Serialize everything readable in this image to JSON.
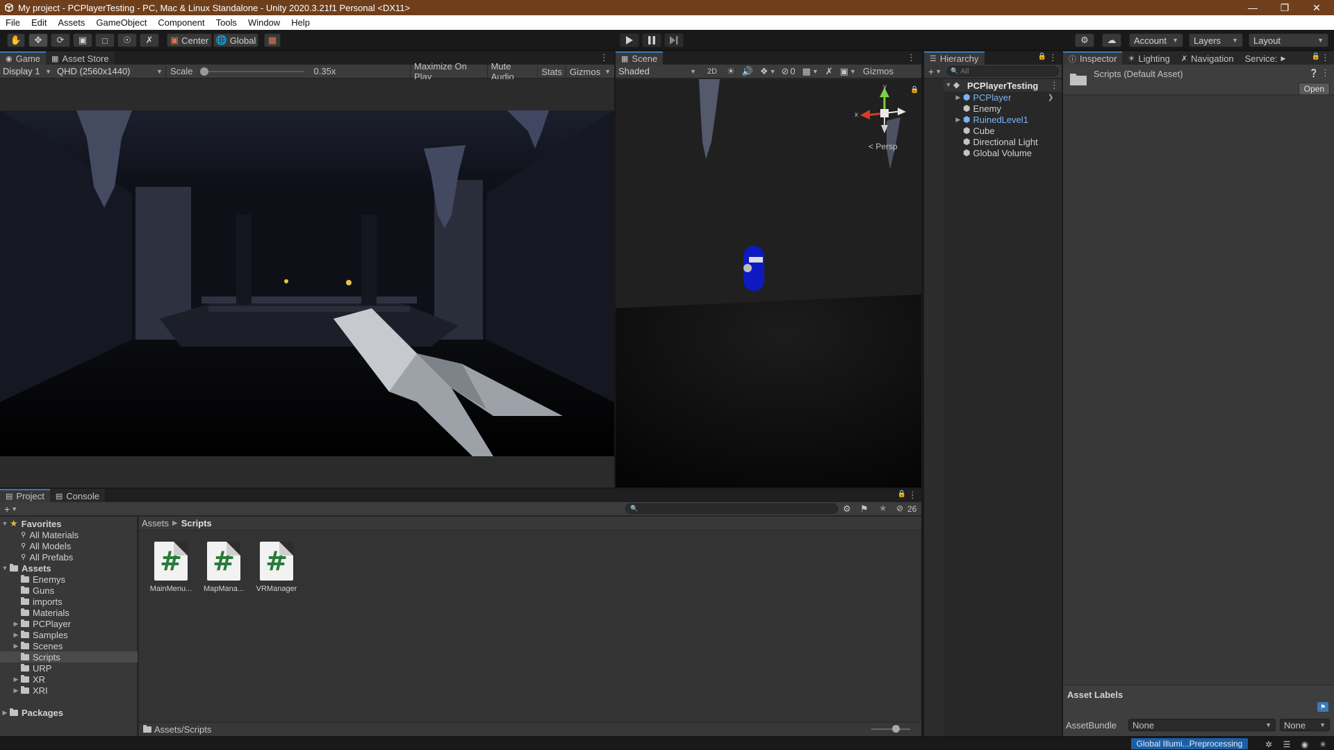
{
  "window": {
    "title": "My project - PCPlayerTesting - PC, Mac & Linux Standalone - Unity 2020.3.21f1 Personal <DX11>",
    "minimize_icon": "minimize-icon",
    "restore_icon": "restore-icon",
    "close_icon": "close-icon"
  },
  "menu": [
    "File",
    "Edit",
    "Assets",
    "GameObject",
    "Component",
    "Tools",
    "Window",
    "Help"
  ],
  "toolbar": {
    "tools": [
      "hand-tool-icon",
      "move-tool-icon",
      "rotate-tool-icon",
      "scale-tool-icon",
      "rect-tool-icon",
      "transform-tool-icon",
      "custom-tool-icon"
    ],
    "pivot": "Center",
    "space": "Global",
    "account": "Account",
    "layers": "Layers",
    "layout": "Layout"
  },
  "game": {
    "tabs": [
      "Game",
      "Asset Store"
    ],
    "display": "Display 1",
    "resolution": "QHD (2560x1440)",
    "scale_label": "Scale",
    "scale_value": "0.35x",
    "scale_fraction": 0.0,
    "maximize": "Maximize On Play",
    "mute": "Mute Audio",
    "stats": "Stats",
    "gizmos": "Gizmos"
  },
  "scene": {
    "tab": "Scene",
    "shading": "Shaded",
    "two_d": "2D",
    "hidden_count": "0",
    "gizmos": "Gizmos",
    "persp": "< Persp",
    "axis_x": "x",
    "axis_y": "y"
  },
  "hierarchy": {
    "tab": "Hierarchy",
    "search_placeholder": "All",
    "root": "PCPlayerTesting",
    "items": [
      {
        "label": "PCPlayer",
        "prefab": true,
        "expandable": true
      },
      {
        "label": "Enemy",
        "prefab": false,
        "expandable": false
      },
      {
        "label": "RuinedLevel1",
        "prefab": true,
        "expandable": true
      },
      {
        "label": "Cube",
        "prefab": false,
        "expandable": false
      },
      {
        "label": "Directional Light",
        "prefab": false,
        "expandable": false
      },
      {
        "label": "Global Volume",
        "prefab": false,
        "expandable": false
      }
    ]
  },
  "inspector": {
    "tabs": [
      "Inspector",
      "Lighting",
      "Navigation",
      "Service:"
    ],
    "asset_title": "Scripts (Default Asset)",
    "open_button": "Open",
    "asset_labels": "Asset Labels",
    "assetbundle_label": "AssetBundle",
    "assetbundle_value": "None",
    "assetbundle_variant": "None"
  },
  "project": {
    "tabs": [
      "Project",
      "Console"
    ],
    "favorites_label": "Favorites",
    "favorites": [
      "All Materials",
      "All Models",
      "All Prefabs"
    ],
    "assets_label": "Assets",
    "folders": [
      {
        "label": "Enemys",
        "expandable": false
      },
      {
        "label": "Guns",
        "expandable": false
      },
      {
        "label": "imports",
        "expandable": false
      },
      {
        "label": "Materials",
        "expandable": false
      },
      {
        "label": "PCPlayer",
        "expandable": true
      },
      {
        "label": "Samples",
        "expandable": true
      },
      {
        "label": "Scenes",
        "expandable": true
      },
      {
        "label": "Scripts",
        "expandable": false
      },
      {
        "label": "URP",
        "expandable": false
      },
      {
        "label": "XR",
        "expandable": true
      },
      {
        "label": "XRI",
        "expandable": true
      }
    ],
    "packages_label": "Packages",
    "breadcrumb": [
      "Assets",
      "Scripts"
    ],
    "hidden_count": "26",
    "files": [
      "MainMenu...",
      "MapMana...",
      "VRManager"
    ],
    "file_glyph": "#",
    "footer_path": "Assets/Scripts"
  },
  "status": {
    "progress_text": "Global Illumi...Preprocessing"
  },
  "colors": {
    "title_bar": "#6f3f1c",
    "accent": "#3a79bb",
    "prefab_text": "#7bb4f2",
    "progress": "#1b5fa8"
  }
}
